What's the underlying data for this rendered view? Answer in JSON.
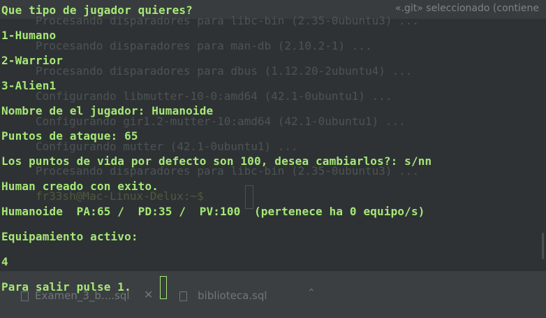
{
  "background_window": {
    "header_note": "«.git» seleccionado (contiene",
    "tabs": [
      {
        "label": "Examen_3_b....sql"
      },
      {
        "label": "biblioteca.sql"
      }
    ],
    "terminal_lines": [
      "Procesando disparadores para libc-bin (2.35-0ubuntu3) ...",
      "Procesando disparadores para man-db (2.10.2-1) ...",
      "Procesando disparadores para dbus (1.12.20-2ubuntu4) ...",
      "Configurando libmutter-10-0:amd64 (42.1-0ubuntu1) ...",
      "Configurando gir1.2-mutter-10:amd64 (42.1-0ubuntu1) ...",
      "Configurando mutter (42.1-0ubuntu1) ...",
      "Procesando disparadores para libc-bin (2.35-0ubuntu3) ..."
    ],
    "prompt": "fr33sh@Mac-Linux-Delux:~$"
  },
  "terminal": {
    "lines": [
      "Que tipo de jugador quieres?",
      "1-Humano",
      "2-Warrior",
      "3-Alien1",
      "Nombre de el jugador: Humanoide",
      "Puntos de ataque: 65",
      "Los puntos de vida por defecto son 100, desea cambiarlos?: s/nn",
      "Human creado con exito.",
      "Humanoide  PA:65 /  PD:35 /  PV:100  (pertenece ha 0 equipo/s)",
      "Equipamiento activo:",
      "4",
      "Para salir pulse 1."
    ]
  },
  "colors": {
    "terminal_text": "#a6e878",
    "background": "#2e3234"
  }
}
